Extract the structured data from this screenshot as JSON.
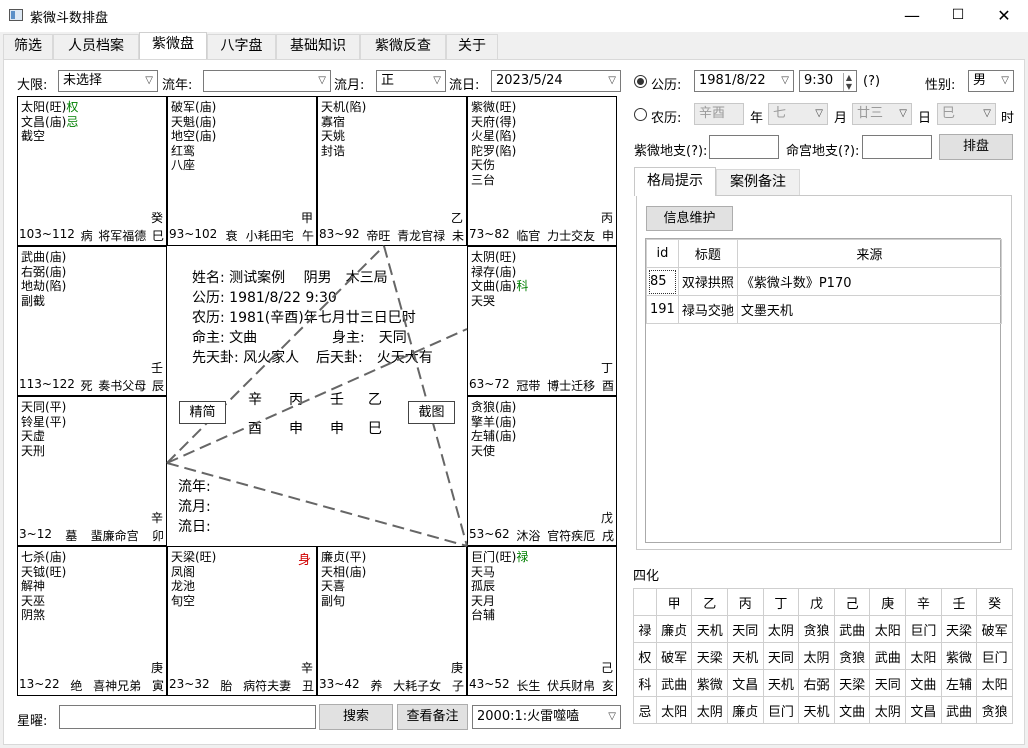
{
  "window": {
    "title": "紫微斗数排盘",
    "minimize": "—",
    "maximize": "☐",
    "close": "✕"
  },
  "tabs": [
    "筛选",
    "人员档案",
    "紫微盘",
    "八字盘",
    "基础知识",
    "紫微反查",
    "关于"
  ],
  "toolbar": {
    "daxian_label": "大限:",
    "daxian_value": "未选择",
    "liunian_label": "流年:",
    "liunian_value": "",
    "liuyue_label": "流月:",
    "liuyue_value": "正",
    "liuri_label": "流日:",
    "liuri_value": "2023/5/24"
  },
  "right_form": {
    "solar_label": "公历:",
    "solar_date": "1981/8/22",
    "solar_time": "9:30",
    "help": "(?)",
    "gender_label": "性别:",
    "gender_value": "男",
    "lunar_label": "农历:",
    "lunar_year": "辛酉",
    "year_unit": "年",
    "lunar_month": "七",
    "month_unit": "月",
    "lunar_day": "廿三",
    "day_unit": "日",
    "lunar_hour": "巳",
    "hour_unit": "时",
    "ziwei_branch_label": "紫微地支(?):",
    "ming_branch_label": "命宫地支(?):",
    "paipan_button": "排盘"
  },
  "palaces": [
    {
      "stars": [
        "太阳(旺)",
        "文昌(庙)",
        "截空"
      ],
      "hua": {
        "0": "权",
        "1": "忌"
      },
      "gan": "癸",
      "range": "103~112",
      "state": "病",
      "gods": "将军福德",
      "branch": "巳"
    },
    {
      "stars": [
        "破军(庙)",
        "天魁(庙)",
        "地空(庙)",
        "红鸾",
        "八座"
      ],
      "hua": {},
      "gan": "甲",
      "range": "93~102",
      "state": "衰",
      "gods": "小耗田宅",
      "branch": "午"
    },
    {
      "stars": [
        "天机(陷)",
        "寡宿",
        "天姚",
        "封诰"
      ],
      "hua": {},
      "gan": "乙",
      "range": "83~92",
      "state": "帝旺",
      "gods": "青龙官禄",
      "branch": "未"
    },
    {
      "stars": [
        "紫微(旺)",
        "天府(得)",
        "火星(陷)",
        "陀罗(陷)",
        "天伤",
        "三台"
      ],
      "hua": {},
      "gan": "丙",
      "range": "73~82",
      "state": "临官",
      "gods": "力士交友",
      "branch": "申"
    },
    {
      "stars": [
        "武曲(庙)",
        "右弼(庙)",
        "地劫(陷)",
        "副截"
      ],
      "hua": {},
      "gan": "壬",
      "range": "113~122",
      "state": "死",
      "gods": "奏书父母",
      "branch": "辰"
    },
    {
      "stars": [
        "太阴(旺)",
        "禄存(庙)",
        "文曲(庙)",
        "天哭"
      ],
      "hua": {
        "2": "科"
      },
      "gan": "丁",
      "range": "63~72",
      "state": "冠带",
      "gods": "博士迁移",
      "branch": "酉"
    },
    {
      "stars": [
        "天同(平)",
        "铃星(平)",
        "天虚",
        "天刑"
      ],
      "hua": {},
      "gan": "辛",
      "range": "3~12",
      "state": "墓",
      "gods": "蜚廉命宫",
      "branch": "卯"
    },
    {
      "stars": [
        "贪狼(庙)",
        "擎羊(庙)",
        "左辅(庙)",
        "天使"
      ],
      "hua": {},
      "gan": "戊",
      "range": "53~62",
      "state": "沐浴",
      "gods": "官符疾厄",
      "branch": "戌"
    },
    {
      "stars": [
        "七杀(庙)",
        "天钺(旺)",
        "解神",
        "天巫",
        "阴煞"
      ],
      "hua": {},
      "gan": "庚",
      "range": "13~22",
      "state": "绝",
      "gods": "喜神兄弟",
      "branch": "寅"
    },
    {
      "stars": [
        "天梁(旺)",
        "凤阁",
        "龙池",
        "旬空"
      ],
      "hua": {},
      "gan": "辛",
      "range": "23~32",
      "state": "胎",
      "gods": "病符夫妻",
      "branch": "丑",
      "shen": "身"
    },
    {
      "stars": [
        "廉贞(平)",
        "天相(庙)",
        "天喜",
        "副旬"
      ],
      "hua": {},
      "gan": "庚",
      "range": "33~42",
      "state": "养",
      "gods": "大耗子女",
      "branch": "子"
    },
    {
      "stars": [
        "巨门(旺)",
        "天马",
        "孤辰",
        "天月",
        "台辅"
      ],
      "hua": {
        "0": "禄"
      },
      "gan": "己",
      "range": "43~52",
      "state": "长生",
      "gods": "伏兵财帛",
      "branch": "亥"
    }
  ],
  "center": {
    "name_line": "姓名: 测试案例　 阴男　木三局",
    "solar_line": "公历: 1981/8/22 9:30",
    "lunar_line": "农历: 1981(辛酉)年七月廿三日巳时",
    "ming_zhu": "命主: 文曲",
    "shen_zhu": "身主:　天同",
    "xiantian": "先天卦: 风火家人",
    "houtian": "后天卦:　火天大有",
    "stems": [
      "辛",
      "丙",
      "壬",
      "乙"
    ],
    "branches": [
      "酉",
      "申",
      "申",
      "巳"
    ],
    "btn_simple": "精简",
    "btn_screenshot": "截图",
    "liunian": "流年:",
    "liuyue": "流月:",
    "liuri": "流日:"
  },
  "pattern": {
    "tab_active": "格局提示",
    "tab_other": "案例备注",
    "info_button": "信息维护",
    "headers": [
      "id",
      "标题",
      "来源"
    ],
    "rows": [
      [
        "85",
        "双禄拱照",
        "《紫微斗数》P170"
      ],
      [
        "191",
        "禄马交驰",
        "文墨天机"
      ]
    ]
  },
  "sihua": {
    "title": "四化",
    "header": [
      "",
      "甲",
      "乙",
      "丙",
      "丁",
      "戊",
      "己",
      "庚",
      "辛",
      "壬",
      "癸"
    ],
    "rows": [
      [
        "禄",
        "廉贞",
        "天机",
        "天同",
        "太阴",
        "贪狼",
        "武曲",
        "太阳",
        "巨门",
        "天梁",
        "破军"
      ],
      [
        "权",
        "破军",
        "天梁",
        "天机",
        "天同",
        "太阴",
        "贪狼",
        "武曲",
        "太阳",
        "紫微",
        "巨门"
      ],
      [
        "科",
        "武曲",
        "紫微",
        "文昌",
        "天机",
        "右弼",
        "天梁",
        "天同",
        "文曲",
        "左辅",
        "太阳"
      ],
      [
        "忌",
        "太阳",
        "太阴",
        "廉贞",
        "巨门",
        "天机",
        "文曲",
        "太阴",
        "文昌",
        "武曲",
        "贪狼"
      ]
    ]
  },
  "bottom": {
    "xingyao_label": "星曜:",
    "search_button": "搜索",
    "note_button": "查看备注",
    "gua_value": "2000:1:火雷噬嗑"
  }
}
